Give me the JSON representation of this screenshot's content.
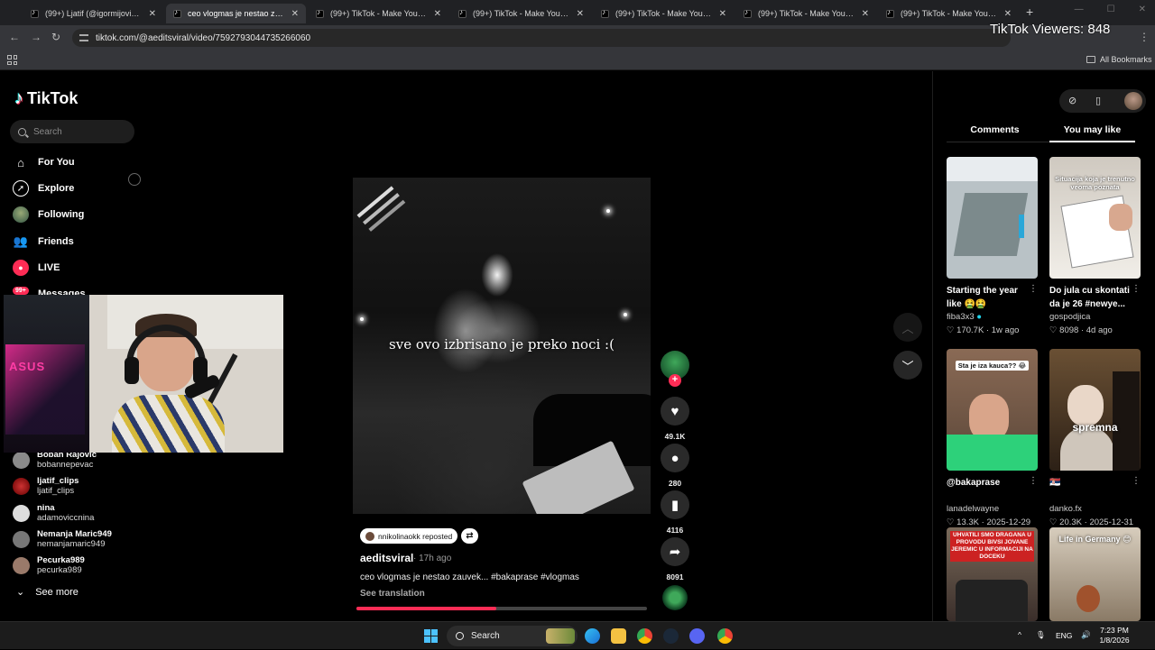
{
  "browser": {
    "tabs": [
      {
        "title": "(99+) Ljatif (@igormijovic00) | T",
        "active": false
      },
      {
        "title": "ceo vlogmas je nestao zauvek...",
        "active": true
      },
      {
        "title": "(99+) TikTok - Make Your Day",
        "active": false
      },
      {
        "title": "(99+) TikTok - Make Your Day",
        "active": false
      },
      {
        "title": "(99+) TikTok - Make Your Day",
        "active": false
      },
      {
        "title": "(99+) TikTok - Make Your Day",
        "active": false
      },
      {
        "title": "(99+) TikTok - Make Your Day",
        "active": false
      }
    ],
    "new_tab": "+",
    "url": "tiktok.com/@aeditsviral/video/7592793044735266060",
    "viewers_overlay": "TikTok Viewers: 848",
    "all_bookmarks": "All Bookmarks"
  },
  "sidebar": {
    "logo": "TikTok",
    "search_placeholder": "Search",
    "nav": [
      {
        "label": "For You",
        "icon": "home-icon"
      },
      {
        "label": "Explore",
        "icon": "compass-icon"
      },
      {
        "label": "Following",
        "icon": "following-avatar-icon"
      },
      {
        "label": "Friends",
        "icon": "friends-icon"
      },
      {
        "label": "LIVE",
        "icon": "live-icon"
      }
    ],
    "messages": {
      "label": "Messages",
      "badge": "99+"
    },
    "following_accounts": [
      {
        "name": "Boban Rajović",
        "username": "bobannepevac"
      },
      {
        "name": "ljatif_clips",
        "username": "ljatif_clips"
      },
      {
        "name": "nina",
        "username": "adamoviccnina"
      },
      {
        "name": "Nemanja Maric949",
        "username": "nemanjamaric949"
      },
      {
        "name": "Pecurka989",
        "username": "pecurka989"
      }
    ],
    "see_more": "See more"
  },
  "webcam": {
    "brand_text": "ASUS"
  },
  "video": {
    "caption_overlay": "sve ovo izbrisano je preko noci :(",
    "reposted_by": "nnikolinaokk reposted",
    "author": "aeditsviral",
    "posted": "· 17h ago",
    "description": "ceo vlogmas je nestao zauvek... #bakaprase #vlogmas",
    "see_translation": "See translation",
    "progress": 0.48
  },
  "actions": {
    "likes": "49.1K",
    "comments": "280",
    "saves": "4116",
    "shares": "8091"
  },
  "right_panel": {
    "tabs": [
      "Comments",
      "You may like"
    ],
    "active_tab": "You may like",
    "cards": [
      {
        "title": "Starting the year like 🤮🤮",
        "author": "fiba3x3",
        "verified": true,
        "likes": "170.7K",
        "date": "1w ago",
        "overlay": ""
      },
      {
        "title": "Do jula cu skontati da je 26 #newye...",
        "author": "gospodjica",
        "verified": false,
        "likes": "8098",
        "date": "4d ago",
        "overlay": "Situacija koja je trenutno veoma poznata"
      },
      {
        "title": "@bakaprase",
        "author": "lanadelwayne",
        "verified": false,
        "likes": "13.3K",
        "date": "2025-12-29",
        "overlay": "Sta je iza kauca?? 😂"
      },
      {
        "title": "🇷🇸",
        "author": "danko.fx",
        "verified": false,
        "likes": "20.3K",
        "date": "2025-12-31",
        "overlay": "spremna"
      },
      {
        "title": "",
        "author": "",
        "verified": false,
        "likes": "",
        "date": "",
        "overlay": "UHVATILI SMO DRAGANA U PROVODU BIVSI JOVANE JEREMIC U INFORMACIJI NA DOCEKU"
      },
      {
        "title": "",
        "author": "",
        "verified": false,
        "likes": "",
        "date": "",
        "overlay": "Life in Germany 😊"
      }
    ]
  },
  "taskbar": {
    "search": "Search",
    "language": "ENG",
    "time": "7:23 PM",
    "date": "1/8/2026"
  },
  "colors": {
    "accent": "#fe2c55",
    "background": "#000000"
  }
}
